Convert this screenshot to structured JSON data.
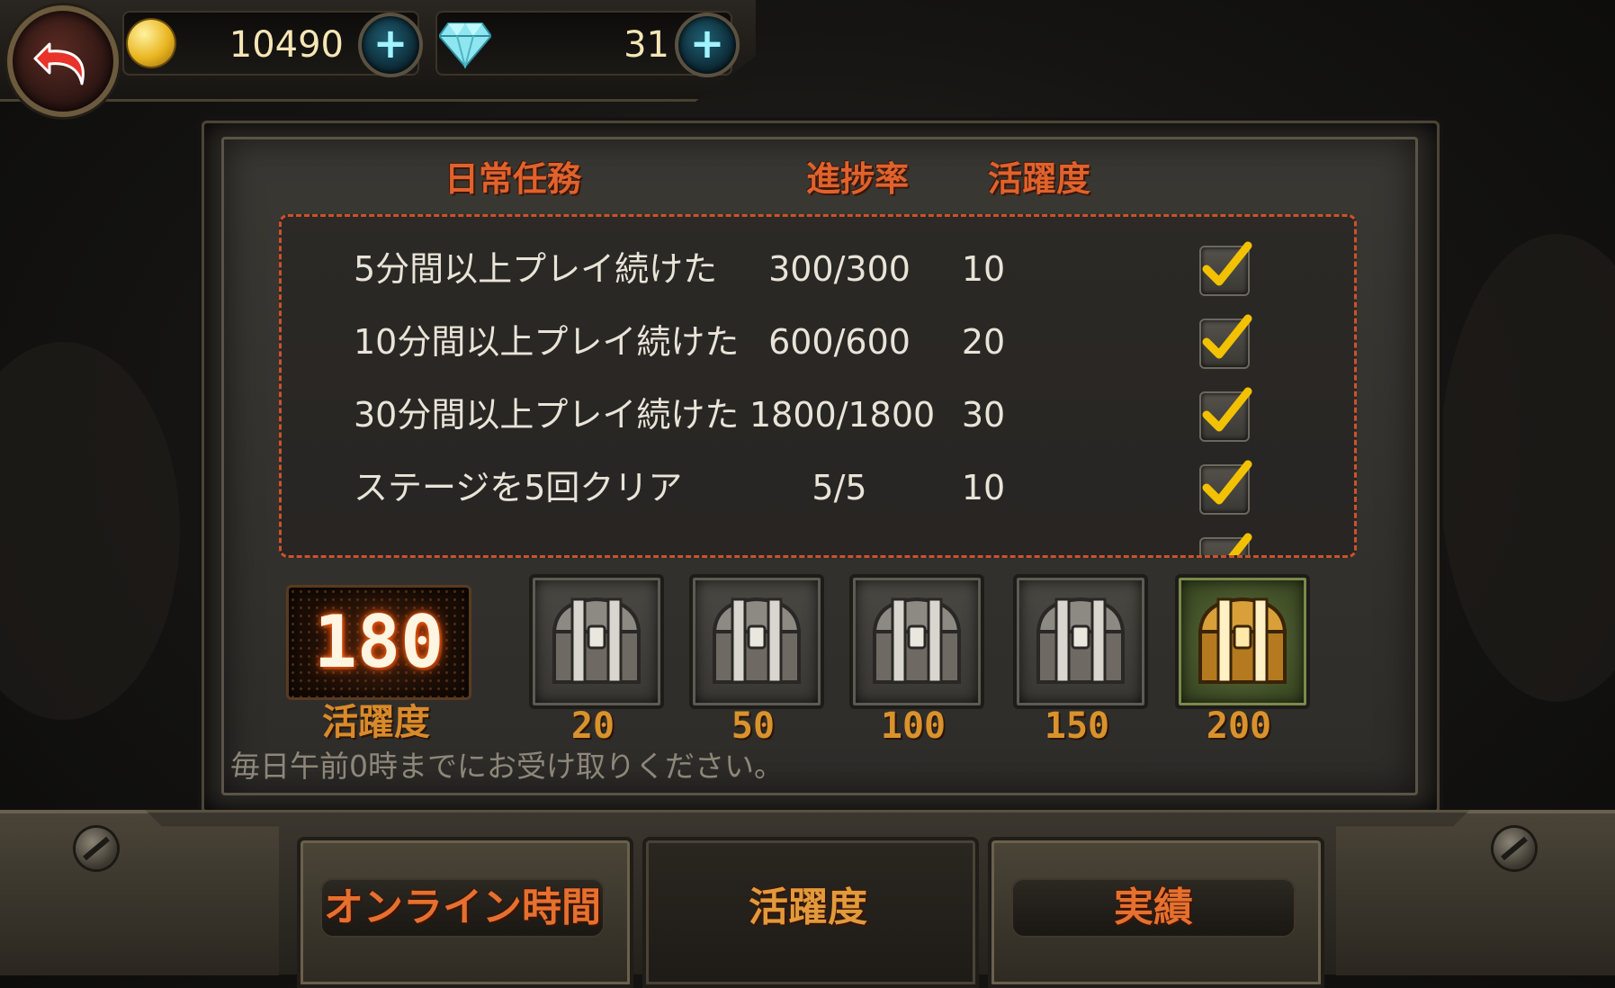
{
  "currency": {
    "gold": "10490",
    "gems": "31"
  },
  "headers": {
    "task": "日常任務",
    "progress": "進捗率",
    "activity": "活躍度"
  },
  "tasks": [
    {
      "name": "5分間以上プレイ続けた",
      "progress": "300/300",
      "activity": "10",
      "done": true
    },
    {
      "name": "10分間以上プレイ続けた",
      "progress": "600/600",
      "activity": "20",
      "done": true
    },
    {
      "name": "30分間以上プレイ続けた",
      "progress": "1800/1800",
      "activity": "30",
      "done": true
    },
    {
      "name": "ステージを5回クリア",
      "progress": "5/5",
      "activity": "10",
      "done": true
    }
  ],
  "activity_score": {
    "value": "180",
    "label": "活躍度"
  },
  "rewards": [
    {
      "threshold": "20",
      "type": "silver"
    },
    {
      "threshold": "50",
      "type": "silver"
    },
    {
      "threshold": "100",
      "type": "silver"
    },
    {
      "threshold": "150",
      "type": "silver"
    },
    {
      "threshold": "200",
      "type": "gold"
    }
  ],
  "note": "毎日午前0時までにお受け取りください。",
  "tabs": [
    {
      "label": "オンライン時間",
      "active": false
    },
    {
      "label": "活躍度",
      "active": true
    },
    {
      "label": "実績",
      "active": false
    }
  ],
  "colors": {
    "header_orange": "#e0622c",
    "dashed_border": "#c9532a",
    "check_yellow": "#f2c200",
    "score_glow": "#ff6a1a"
  },
  "icons": {
    "back": "back-arrow-icon",
    "gold": "gold-coin-icon",
    "gem": "diamond-icon",
    "plus": "plus-icon",
    "check": "checkmark-icon",
    "chest": "treasure-chest-icon"
  }
}
